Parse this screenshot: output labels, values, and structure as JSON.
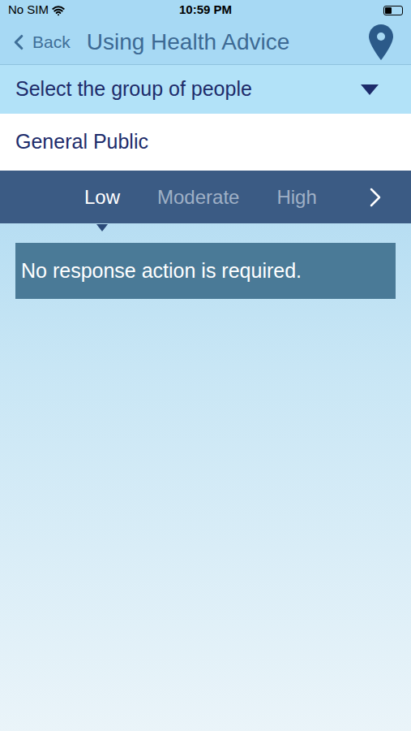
{
  "status_bar": {
    "carrier": "No SIM",
    "time": "10:59 PM",
    "battery": {
      "level": 0.4
    }
  },
  "nav": {
    "back": "Back",
    "title": "Using Health Advice"
  },
  "group_select": {
    "label": "Select the group of people",
    "value": "General Public"
  },
  "tabs": [
    {
      "label": "Low",
      "selected": true
    },
    {
      "label": "Moderate",
      "selected": false
    },
    {
      "label": "High",
      "selected": false
    }
  ],
  "advice": "No response action is required."
}
